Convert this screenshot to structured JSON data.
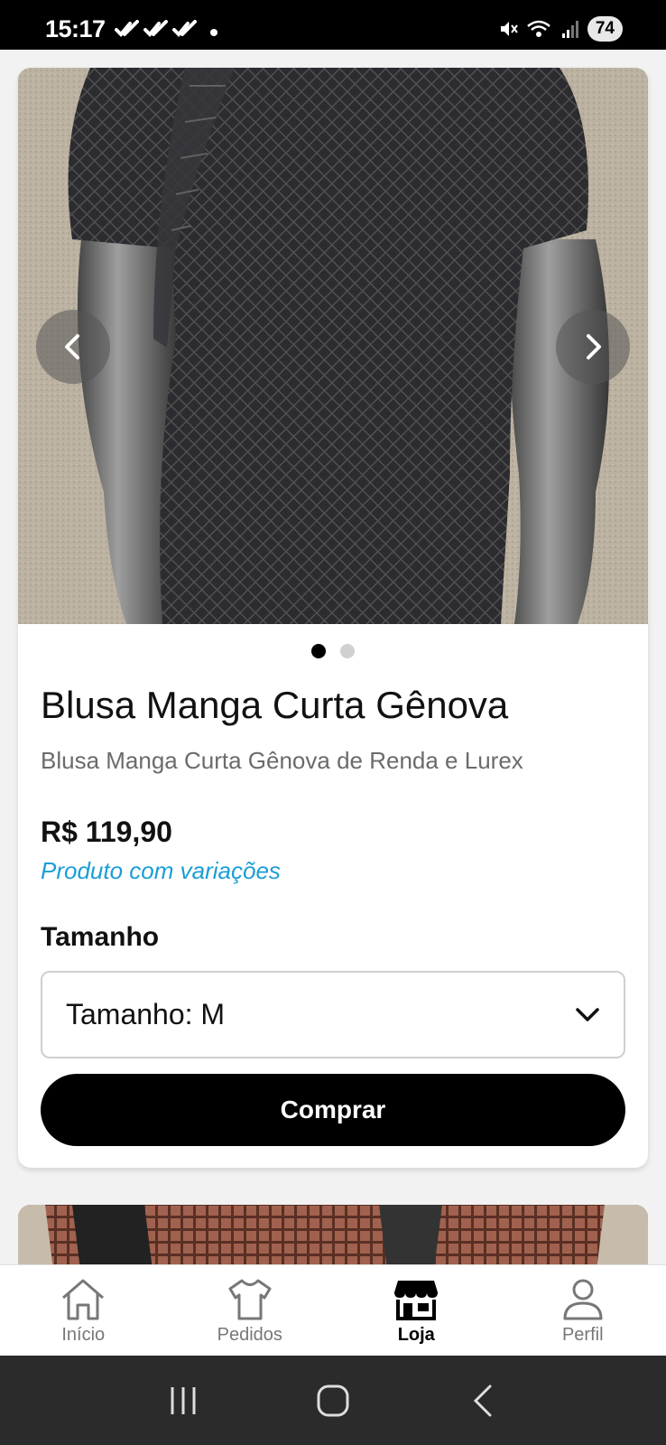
{
  "status_bar": {
    "time": "15:17",
    "battery": "74",
    "icons": [
      "check-double-icon",
      "check-double-icon",
      "check-double-icon",
      "notification-dot",
      "mute-icon",
      "wifi-icon",
      "signal-icon",
      "battery-icon"
    ]
  },
  "product": {
    "title": "Blusa Manga Curta Gênova",
    "subtitle": "Blusa Manga Curta Gênova de Renda e Lurex",
    "price": "R$ 119,90",
    "variations_note": "Produto com variações",
    "carousel": {
      "total_images": 2,
      "active_index": 0
    },
    "size_label": "Tamanho",
    "size_select_value": "Tamanho: M",
    "buy_label": "Comprar"
  },
  "bottom_nav": {
    "items": [
      {
        "label": "Início",
        "icon": "home-icon",
        "active": false
      },
      {
        "label": "Pedidos",
        "icon": "tshirt-icon",
        "active": false
      },
      {
        "label": "Loja",
        "icon": "store-icon",
        "active": true
      },
      {
        "label": "Perfil",
        "icon": "person-icon",
        "active": false
      }
    ]
  },
  "colors": {
    "accent": "#1a9ed6",
    "primary_button": "#000000",
    "status_bar": "#000000",
    "system_nav": "#2b2b2b"
  }
}
